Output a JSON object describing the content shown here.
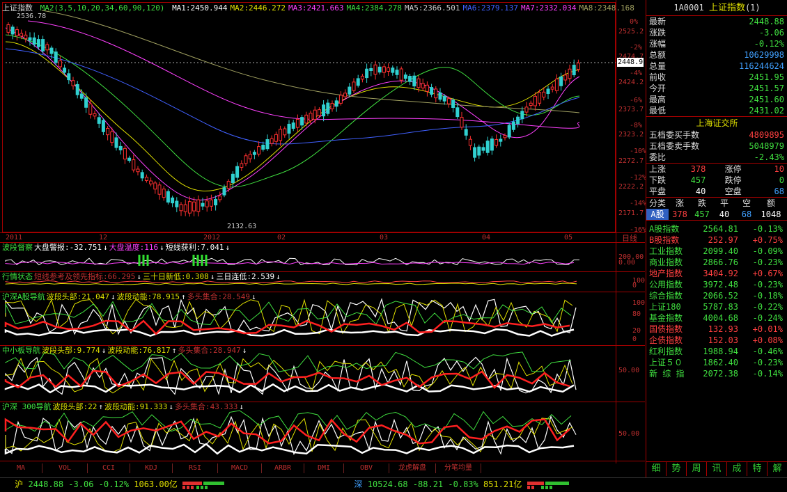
{
  "main_chart": {
    "symbol": "上证指数",
    "ma_params": "MA2(3,5,10,20,34,60,90,120)",
    "ma_values": [
      {
        "label": "MA1:2450.944",
        "color": "#ffffff"
      },
      {
        "label": "MA2:2446.272",
        "color": "#e0e000"
      },
      {
        "label": "MA3:2421.663",
        "color": "#ff40ff"
      },
      {
        "label": "MA4:2384.278",
        "color": "#40e040"
      },
      {
        "label": "MA5:2366.501",
        "color": "#cccccc"
      },
      {
        "label": "MA6:2379.137",
        "color": "#4060ff"
      },
      {
        "label": "MA7:2332.034",
        "color": "#ff40ff"
      },
      {
        "label": "MA8:2348.168",
        "color": "#a0a060"
      }
    ],
    "high_label": "2536.78",
    "low_label": "2132.63",
    "current_price_tag": "2448.9",
    "price_ticks": [
      "2525.2",
      "2474.7",
      "2424.2",
      "2373.7",
      "2323.2",
      "2272.7",
      "2222.2",
      "2171.7"
    ],
    "pct_ticks": [
      "0%",
      "-2%",
      "-4%",
      "-6%",
      "-8%",
      "-10%",
      "-12%",
      "-14%",
      "-16%"
    ],
    "date_ticks": [
      "2011",
      "12",
      "2012",
      "02",
      "03",
      "04",
      "05"
    ],
    "period": "日线"
  },
  "panes": [
    {
      "title": "波段督察",
      "items": [
        {
          "t": "大盘警报:-32.751",
          "c": "#ffffff",
          "arrow": "↓"
        },
        {
          "t": "大盘温度:116",
          "c": "#ff40ff",
          "arrow": "↓"
        },
        {
          "t": "短线获利:7.041",
          "c": "#ffffff",
          "arrow": "↓"
        }
      ],
      "ticks": [
        "200.00",
        "0.00"
      ]
    },
    {
      "title": "行情状态",
      "items": [
        {
          "t": "短线参考及领先指标:66.295",
          "c": "#c03030",
          "arrow": "↓"
        },
        {
          "t": "三十日新低:0.308",
          "c": "#e0e000",
          "arrow": "↓"
        },
        {
          "t": "三日连低:2.539",
          "c": "#ffffff",
          "arrow": "↓"
        }
      ],
      "ticks": [
        "100",
        "0"
      ]
    },
    {
      "title": "沪深A股导航",
      "items": [
        {
          "t": "波段头部:21.047",
          "c": "#e0e000",
          "arrow": "↓"
        },
        {
          "t": "波段动能:78.915",
          "c": "#e0e000",
          "arrow": "↑"
        },
        {
          "t": "多头集合:28.549",
          "c": "#c03030",
          "arrow": "↓"
        }
      ],
      "ticks": [
        "100",
        "80",
        "20",
        "0"
      ]
    },
    {
      "title": "中小板导航",
      "items": [
        {
          "t": "波段头部:9.774",
          "c": "#e0e000",
          "arrow": "↓"
        },
        {
          "t": "波段动能:76.817",
          "c": "#e0e000",
          "arrow": "↑"
        },
        {
          "t": "多头集合:28.947",
          "c": "#c03030",
          "arrow": "↓"
        }
      ],
      "ticks": [
        "50.00"
      ]
    },
    {
      "title": "沪深 300导航",
      "items": [
        {
          "t": "波段头部:22",
          "c": "#e0e000",
          "arrow": "↑"
        },
        {
          "t": "波段动能:91.333",
          "c": "#e0e000",
          "arrow": "↓"
        },
        {
          "t": "多头集合:43.333",
          "c": "#c03030",
          "arrow": "↓"
        }
      ],
      "ticks": [
        "50.00"
      ]
    }
  ],
  "bottom_tabs": [
    "MA",
    "VOL",
    "CCI",
    "KDJ",
    "RSI",
    "MACD",
    "ARBR",
    "DMI",
    "OBV",
    "龙虎解盘",
    "分笔均量"
  ],
  "status_bar": {
    "sh_label": "沪",
    "sh_value": "2448.88",
    "sh_change": "-3.06",
    "sh_pct": "-0.12%",
    "sh_amount": "1063.00亿",
    "sz_label": "深",
    "sz_value": "10524.68",
    "sz_change": "-88.21",
    "sz_pct": "-0.83%",
    "sz_amount": "851.21亿"
  },
  "right_panel": {
    "code": "1A0001",
    "name": "上证指数",
    "count": "(1)",
    "quote": [
      {
        "k": "最新",
        "v": "2448.88",
        "c": "#40e040"
      },
      {
        "k": "涨跌",
        "v": "-3.06",
        "c": "#40e040"
      },
      {
        "k": "涨幅",
        "v": "-0.12%",
        "c": "#40e040"
      },
      {
        "k": "总额",
        "v": "10629998",
        "c": "#40a0ff"
      },
      {
        "k": "总量",
        "v": "116244624",
        "c": "#40a0ff"
      },
      {
        "k": "前收",
        "v": "2451.95",
        "c": "#40e040"
      },
      {
        "k": "今开",
        "v": "2451.57",
        "c": "#40e040"
      },
      {
        "k": "最高",
        "v": "2451.60",
        "c": "#40e040"
      },
      {
        "k": "最低",
        "v": "2431.02",
        "c": "#40e040"
      }
    ],
    "exchange": "上海证交所",
    "order_book": [
      {
        "k": "五档委买手数",
        "v": "4809895",
        "c": "#ff4040"
      },
      {
        "k": "五档委卖手数",
        "v": "5048979",
        "c": "#40e040"
      },
      {
        "k": "委比",
        "v": "-2.43%",
        "c": "#40e040"
      }
    ],
    "breadth": [
      {
        "k1": "上涨",
        "v1": "378",
        "c1": "#ff4040",
        "k2": "涨停",
        "v2": "10",
        "c2": "#ff4040"
      },
      {
        "k1": "下跌",
        "v1": "457",
        "c1": "#40e040",
        "k2": "跌停",
        "v2": "0",
        "c2": "#40e040"
      },
      {
        "k1": "平盘",
        "v1": "40",
        "c1": "#ffffff",
        "k2": "空盘",
        "v2": "68",
        "c2": "#40a0ff"
      }
    ],
    "class_header": [
      "分类",
      "涨",
      "跌",
      "平",
      "空",
      "额"
    ],
    "class_row": {
      "name": "A股",
      "up": "378",
      "down": "457",
      "flat": "40",
      "empty": "68",
      "amount": "1048"
    },
    "indices": [
      {
        "n": "A股指数",
        "v": "2564.81",
        "p": "-0.13%",
        "c": "#40e040"
      },
      {
        "n": "B股指数",
        "v": "252.97",
        "p": "+0.75%",
        "c": "#ff4040"
      },
      {
        "n": "工业指数",
        "v": "2099.40",
        "p": "-0.09%",
        "c": "#40e040"
      },
      {
        "n": "商业指数",
        "v": "2866.76",
        "p": "-0.23%",
        "c": "#40e040"
      },
      {
        "n": "地产指数",
        "v": "3404.92",
        "p": "+0.67%",
        "c": "#ff4040"
      },
      {
        "n": "公用指数",
        "v": "3972.48",
        "p": "-0.23%",
        "c": "#40e040"
      },
      {
        "n": "综合指数",
        "v": "2066.52",
        "p": "-0.18%",
        "c": "#40e040"
      },
      {
        "n": "上证180",
        "v": "5787.83",
        "p": "-0.22%",
        "c": "#40e040"
      },
      {
        "n": "基金指数",
        "v": "4004.68",
        "p": "-0.24%",
        "c": "#40e040"
      },
      {
        "n": "国债指数",
        "v": "132.93",
        "p": "+0.01%",
        "c": "#ff4040"
      },
      {
        "n": "企债指数",
        "v": "152.03",
        "p": "+0.08%",
        "c": "#ff4040"
      },
      {
        "n": "红利指数",
        "v": "1988.94",
        "p": "-0.46%",
        "c": "#40e040"
      },
      {
        "n": "上证５０",
        "v": "1862.40",
        "p": "-0.23%",
        "c": "#40e040"
      },
      {
        "n": "新 综 指",
        "v": "2072.38",
        "p": "-0.14%",
        "c": "#40e040"
      }
    ],
    "tabs": [
      "细",
      "势",
      "周",
      "讯",
      "成",
      "特",
      "解"
    ]
  }
}
